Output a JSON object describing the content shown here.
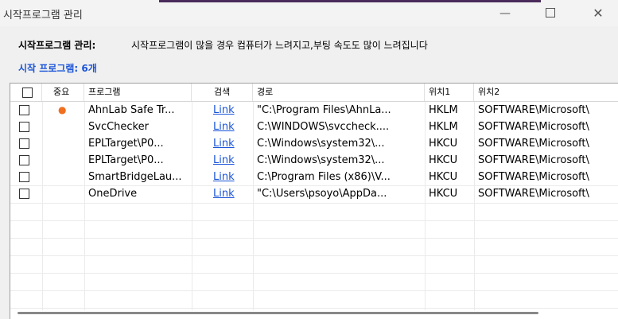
{
  "window": {
    "title": "시작프로그램 관리",
    "minimize_glyph": "—",
    "close_glyph": "✕"
  },
  "description": {
    "label": "시작프로그램 관리:",
    "text": "시작프로그램이 많을 경우 컴퓨터가 느려지고,부팅 속도도 많이 느려집니다"
  },
  "count_label": "시작 프로그램: 6개",
  "columns": [
    "",
    "중요",
    "프로그램",
    "검색",
    "경로",
    "위치1",
    "위치2"
  ],
  "rows": [
    {
      "important": "●",
      "program": "AhnLab Safe Tr...",
      "search": "Link",
      "path": "\"C:\\Program Files\\AhnLa...",
      "loc1": "HKLM",
      "loc2": "SOFTWARE\\Microsoft\\"
    },
    {
      "important": "",
      "program": "SvcChecker",
      "search": "Link",
      "path": "C:\\WINDOWS\\svccheck....",
      "loc1": "HKLM",
      "loc2": "SOFTWARE\\Microsoft\\"
    },
    {
      "important": "",
      "program": "EPLTarget\\P0...",
      "search": "Link",
      "path": "C:\\Windows\\system32\\...",
      "loc1": "HKCU",
      "loc2": "SOFTWARE\\Microsoft\\"
    },
    {
      "important": "",
      "program": "EPLTarget\\P0...",
      "search": "Link",
      "path": "C:\\Windows\\system32\\...",
      "loc1": "HKCU",
      "loc2": "SOFTWARE\\Microsoft\\"
    },
    {
      "important": "",
      "program": "SmartBridgeLau...",
      "search": "Link",
      "path": "C:\\Program Files (x86)\\V...",
      "loc1": "HKCU",
      "loc2": "SOFTWARE\\Microsoft\\"
    },
    {
      "important": "",
      "program": "OneDrive",
      "search": "Link",
      "path": "\"C:\\Users\\psoyo\\AppDa...",
      "loc1": "HKCU",
      "loc2": "SOFTWARE\\Microsoft\\"
    }
  ],
  "colors": {
    "accent_blue": "#1a54d8",
    "important_dot": "#f07020"
  }
}
